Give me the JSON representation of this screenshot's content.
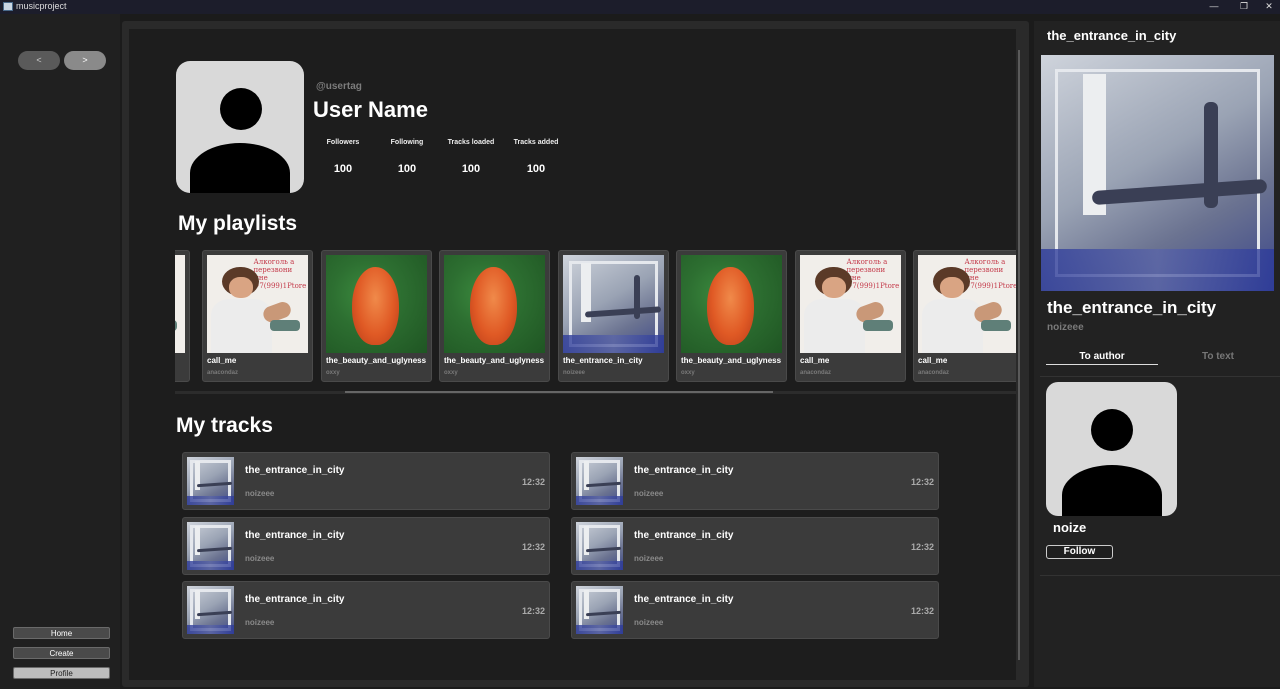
{
  "window": {
    "title": "musicproject",
    "minimize": "—",
    "restore": "❐",
    "close": "✕"
  },
  "sidebar": {
    "back_label": "<",
    "forward_label": ">",
    "home_label": "Home",
    "create_label": "Create",
    "profile_label": "Profile"
  },
  "profile": {
    "usertag": "@usertag",
    "username": "User Name",
    "stats": [
      {
        "label": "Followers",
        "value": "100"
      },
      {
        "label": "Following",
        "value": "100"
      },
      {
        "label": "Tracks loaded",
        "value": "100"
      },
      {
        "label": "Tracks added",
        "value": "100"
      }
    ]
  },
  "playlists": {
    "title": "My playlists",
    "items": [
      {
        "title": "call_me",
        "author": "anacondaz",
        "art": "man"
      },
      {
        "title": "the_beauty_and_uglyness",
        "author": "oxxy",
        "art": "tongue"
      },
      {
        "title": "the_beauty_and_uglyness",
        "author": "oxxy",
        "art": "tongue"
      },
      {
        "title": "the_entrance_in_city",
        "author": "noizeee",
        "art": "city"
      },
      {
        "title": "the_beauty_and_uglyness",
        "author": "oxxy",
        "art": "tongue"
      },
      {
        "title": "call_me",
        "author": "anacondaz",
        "art": "man"
      },
      {
        "title": "call_me",
        "author": "anacondaz",
        "art": "man"
      }
    ],
    "cover_text": "Алкоголь а перезвони мне +7(999)1Ptore"
  },
  "tracks": {
    "title": "My tracks",
    "items": [
      {
        "title": "the_entrance_in_city",
        "author": "noizeee",
        "duration": "12:32"
      },
      {
        "title": "the_entrance_in_city",
        "author": "noizeee",
        "duration": "12:32"
      },
      {
        "title": "the_entrance_in_city",
        "author": "noizeee",
        "duration": "12:32"
      },
      {
        "title": "the_entrance_in_city",
        "author": "noizeee",
        "duration": "12:32"
      },
      {
        "title": "the_entrance_in_city",
        "author": "noizeee",
        "duration": "12:32"
      },
      {
        "title": "the_entrance_in_city",
        "author": "noizeee",
        "duration": "12:32"
      }
    ]
  },
  "now_playing": {
    "header_title": "the_entrance_in_city",
    "title": "the_entrance_in_city",
    "author": "noizeee",
    "tab_author": "To author",
    "tab_text": "To text",
    "author_name": "noize",
    "follow_label": "Follow"
  }
}
